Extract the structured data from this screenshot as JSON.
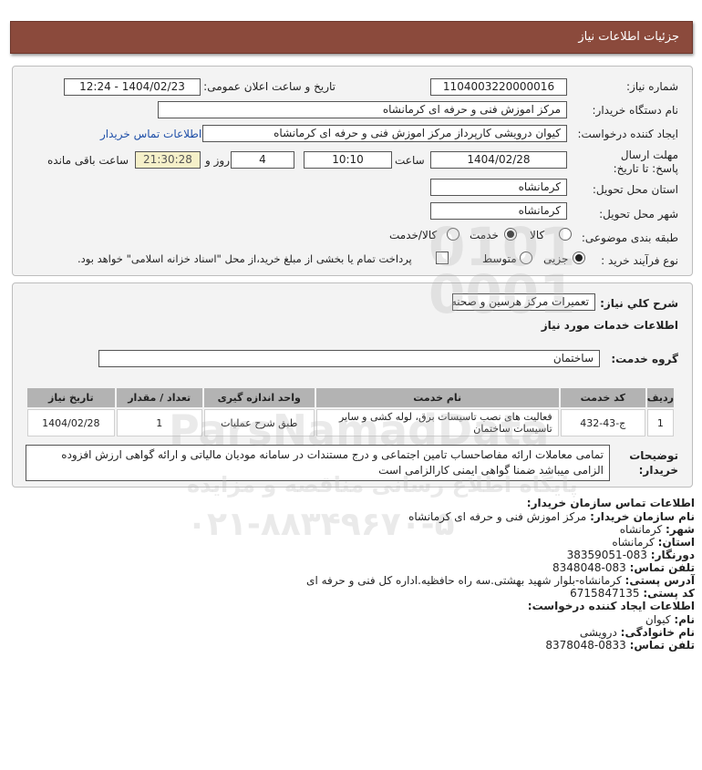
{
  "title": "جزئیات اطلاعات نیاز",
  "need": {
    "number_label": "شماره نیاز:",
    "number": "1104003220000016",
    "announce_label": "تاریخ و ساعت اعلان عمومی:",
    "announce": "1404/02/23 - 12:24",
    "buyer_label": "نام دستگاه خریدار:",
    "buyer": "مرکز اموزش فنی و حرفه ای کرمانشاه",
    "creator_label": "ایجاد کننده درخواست:",
    "creator": "کیوان درویشی کارپرداز مرکز اموزش فنی و حرفه ای کرمانشاه",
    "contact_link": "اطلاعات تماس خریدار",
    "deadline_label": "مهلت ارسال پاسخ: تا تاریخ:",
    "deadline_date": "1404/02/28",
    "time_label": "ساعت",
    "deadline_time": "10:10",
    "days": "4",
    "days_label": "روز و",
    "remaining": "21:30:28",
    "remaining_label": "ساعت باقی مانده",
    "province_label": "استان محل تحویل:",
    "province": "کرمانشاه",
    "city_label": "شهر محل تحویل:",
    "city": "کرمانشاه",
    "category_label": "طبقه بندی موضوعی:",
    "category_options": [
      "کالا",
      "خدمت",
      "کالا/خدمت"
    ],
    "category_selected": "خدمت",
    "process_label": "نوع فرآیند خرید :",
    "process_options": [
      "جزیی",
      "متوسط"
    ],
    "process_selected": "جزیی",
    "payment_note": "پرداخت تمام یا بخشی از مبلغ خرید،از محل \"اسناد خزانه اسلامی\" خواهد بود."
  },
  "summary": {
    "label": "شرح کلي نياز:",
    "value": "تعمیرات مرکز هرسین و صحنه",
    "services_heading": "اطلاعات خدمات مورد نياز",
    "group_label": "گروه خدمت:",
    "group_value": "ساختمان",
    "table_headers": [
      "ردیف",
      "کد خدمت",
      "نام خدمت",
      "واحد اندازه گیری",
      "تعداد / مقدار",
      "تاریخ نیاز"
    ],
    "table_rows": [
      [
        "1",
        "ج-43-432",
        "فعالیت های نصب تاسیسات برق، لوله کشی و سایر تاسیسات ساختمان",
        "طبق شرح عملیات",
        "1",
        "1404/02/28"
      ]
    ],
    "buyer_notes_label": "توضیحات خریدار:",
    "buyer_notes": "تمامی معاملات ارائه مفاصاحساب تامین اجتماعی و درج مستندات در سامانه مودیان مالیاتی و ارائه گواهی ارزش افزوده الزامی میباشد ضمنا گواهی ایمنی کارالزامی است"
  },
  "contact": {
    "heading": "اطلاعات تماس سازمان خریدار:",
    "lines": [
      {
        "label": "نام سازمان خریدار:",
        "value": "مرکز اموزش فنی و حرفه ای کرمانشاه"
      },
      {
        "label": "شهر:",
        "value": "کرمانشاه"
      },
      {
        "label": "استان:",
        "value": "کرمانشاه"
      },
      {
        "label": "دورنگار:",
        "value": "083-38359051"
      },
      {
        "label": "تلفن تماس:",
        "value": "083-8348048"
      },
      {
        "label": "آدرس پستی:",
        "value": "کرمانشاه-بلوار شهید بهشتی.سه راه حافظیه.اداره کل فنی و حرفه ای"
      },
      {
        "label": "کد پستی:",
        "value": "6715847135"
      }
    ],
    "creator_heading": "اطلاعات ایجاد کننده درخواست:",
    "creator_lines": [
      {
        "label": "نام:",
        "value": "کیوان"
      },
      {
        "label": "نام خانوادگی:",
        "value": "درویشی"
      },
      {
        "label": "تلفن تماس:",
        "value": "0833-8378048"
      }
    ]
  },
  "watermark": {
    "site": "ParsNamadData",
    "tagline": "پایگاه اطلاع رسانی مناقصه و مزایده",
    "phone": "۰۲۱-۸۸۳۴۹۶۷۰-۵",
    "digits": "0101 0001"
  },
  "colors": {
    "title_bar": "#8b4a3c",
    "panel": "#f3f3f3",
    "table_header": "#b3b3b3",
    "link": "#1f4fa8",
    "remaining_bg": "#f5f0c9"
  }
}
